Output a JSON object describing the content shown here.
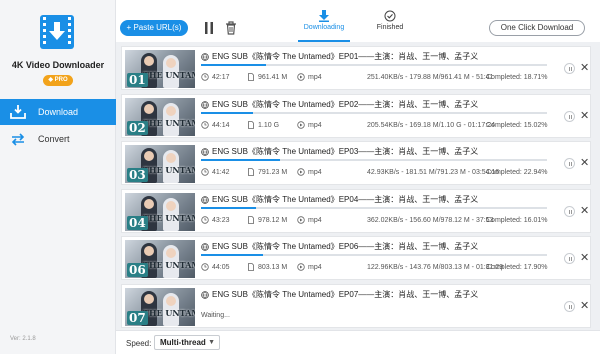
{
  "app": {
    "title": "4K Video Downloader",
    "badge": "PRO",
    "version": "Ver: 2.1.8"
  },
  "nav": [
    {
      "label": "Download",
      "icon": "download-tray-icon",
      "active": true
    },
    {
      "label": "Convert",
      "icon": "convert-arrows-icon",
      "active": false
    }
  ],
  "toolbar": {
    "paste_label": "+ Paste URL(s)",
    "tab_downloading": "Downloading",
    "tab_finished": "Finished",
    "one_click_label": "One Click Download"
  },
  "downloads": [
    {
      "num": "01",
      "title": "ENG SUB《陈情令 The Untamed》EP01——主演：肖战、王一博、孟子义",
      "duration": "42:17",
      "size": "961.41 M",
      "format": "mp4",
      "progress_text": "251.40KB/s - 179.88 M/961.41 M - 51:41",
      "completed": "Completed: 18.71%",
      "progress": 0.1871,
      "thumb_text": "THE UNTAMED"
    },
    {
      "num": "02",
      "title": "ENG SUB《陈情令 The Untamed》EP02——主演：肖战、王一博、孟子义",
      "duration": "44:14",
      "size": "1.10 G",
      "format": "mp4",
      "progress_text": "205.54KB/s - 169.18 M/1.10 G - 01:17:24",
      "completed": "Completed: 15.02%",
      "progress": 0.1502,
      "thumb_text": "THE UNTAMED"
    },
    {
      "num": "03",
      "title": "ENG SUB《陈情令 The Untamed》EP03——主演：肖战、王一博、孟子义",
      "duration": "41:42",
      "size": "791.23 M",
      "format": "mp4",
      "progress_text": "42.93KB/s - 181.51 M/791.23 M - 03:54:16",
      "completed": "Completed: 22.94%",
      "progress": 0.2294,
      "thumb_text": "THE UNTAMED"
    },
    {
      "num": "04",
      "title": "ENG SUB《陈情令 The Untamed》EP04——主演：肖战、王一博、孟子义",
      "duration": "43:23",
      "size": "978.12 M",
      "format": "mp4",
      "progress_text": "362.02KB/s - 156.60 M/978.12 M - 37:53",
      "completed": "Completed: 16.01%",
      "progress": 0.1601,
      "thumb_text": "THE UNTAMED"
    },
    {
      "num": "06",
      "title": "ENG SUB《陈情令 The Untamed》EP06——主演：肖战、王一博、孟子义",
      "duration": "44:05",
      "size": "803.13 M",
      "format": "mp4",
      "progress_text": "122.96KB/s - 143.76 M/803.13 M - 01:31:29",
      "completed": "Completed: 17.90%",
      "progress": 0.179,
      "thumb_text": "THE UNTAMED"
    },
    {
      "num": "07",
      "title": "ENG SUB《陈情令 The Untamed》EP07——主演：肖战、王一博、孟子义",
      "status": "Waiting...",
      "thumb_text": "THE UNTAMED"
    }
  ],
  "speed": {
    "label": "Speed:",
    "value": "Multi-thread"
  },
  "colors": {
    "accent": "#1a8fe6",
    "pro": "#f2a31b",
    "sidebar": "#f4f5f7"
  }
}
